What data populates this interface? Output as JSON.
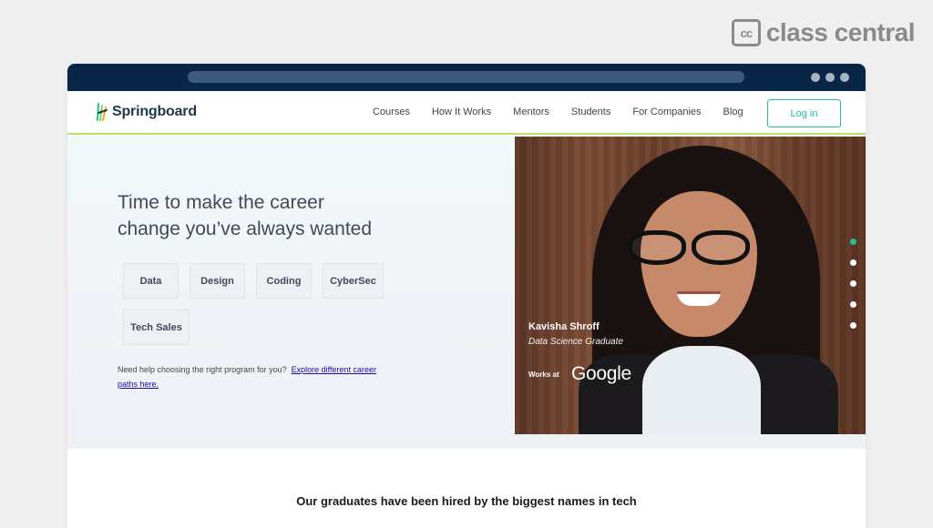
{
  "watermark": {
    "mark": "cc",
    "text": "class central"
  },
  "nav": {
    "brand": "Springboard",
    "links": [
      "Courses",
      "How It Works",
      "Mentors",
      "Students",
      "For Companies",
      "Blog"
    ],
    "login": "Log in"
  },
  "hero": {
    "headline_line1": "Time to make the career",
    "headline_line2": "change you’ve always wanted",
    "chips": [
      "Data",
      "Design",
      "Coding",
      "CyberSec",
      "Tech Sales"
    ],
    "help_text": "Need help choosing the right program for you?",
    "help_link": "Explore different career paths here.",
    "graduate": {
      "name": "Kavisha Shroff",
      "role": "Data Science Graduate",
      "works_at": "Works at",
      "company": "Google"
    },
    "carousel": {
      "count": 5,
      "active_index": 0
    }
  },
  "section": {
    "title": "Our graduates have been hired by the biggest names in tech"
  },
  "colors": {
    "accent": "#1fbf9d",
    "nav_bar": "#0a2647",
    "underline": "#b6e36c"
  }
}
